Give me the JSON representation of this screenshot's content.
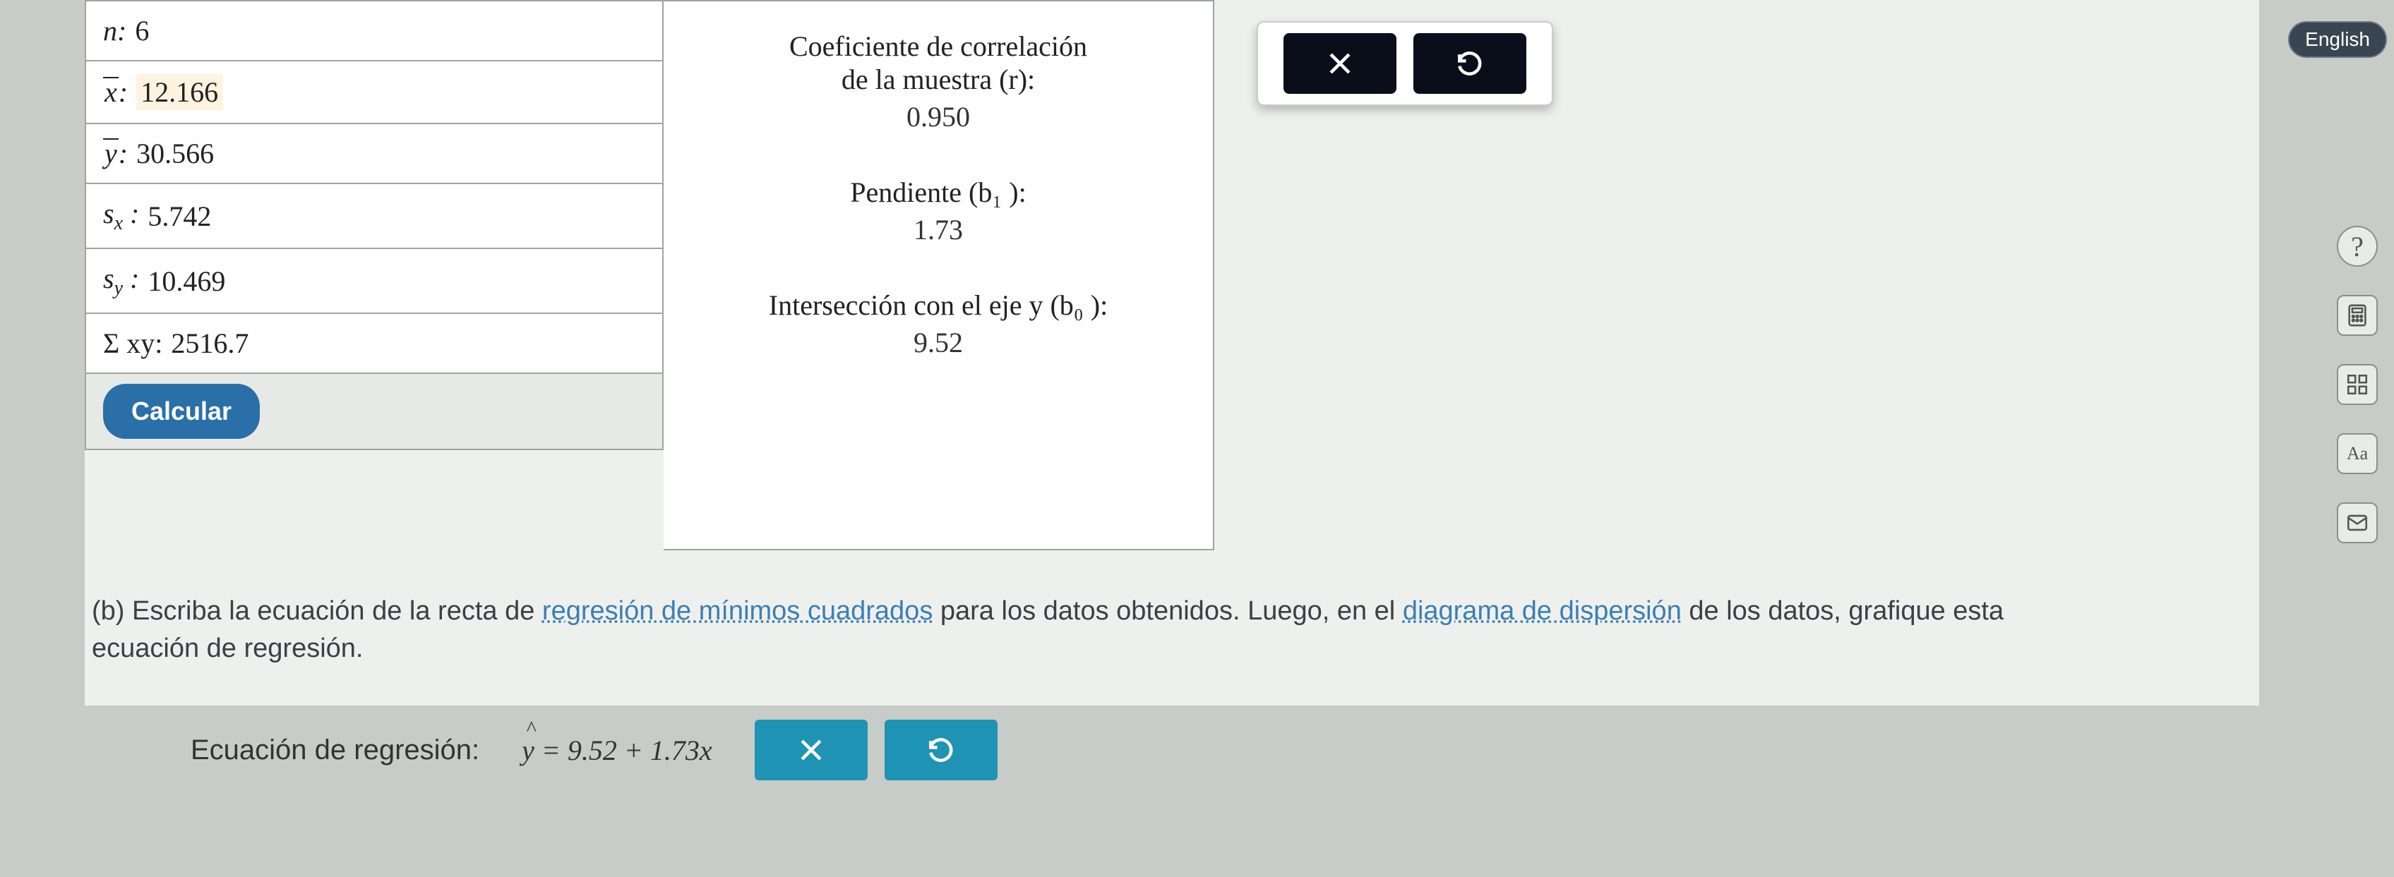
{
  "stats": {
    "n_label": "n",
    "n_value": "6",
    "xbar_label": "x",
    "xbar_value": "12.166",
    "ybar_label": "y",
    "ybar_value": "30.566",
    "sx_label_base": "s",
    "sx_label_sub": "x",
    "sx_value": "5.742",
    "sy_label_base": "s",
    "sy_label_sub": "y",
    "sy_value": "10.469",
    "sumxy_label": "Σ xy",
    "sumxy_value": "2516.7",
    "calc_button": "Calcular"
  },
  "results": {
    "r_label1": "Coeficiente de correlación",
    "r_label2": "de la muestra (r):",
    "r_value": "0.950",
    "b1_label": "Pendiente (b₁ ):",
    "b1_value": "1.73",
    "b0_label": "Intersección con el eje y (b₀ ):",
    "b0_value": "9.52"
  },
  "lang_button": "English",
  "question": {
    "part_label": "(b)",
    "t1": "Escriba la ecuación de la recta de ",
    "link1": "regresión de mínimos cuadrados",
    "t2": " para los datos obtenidos. Luego, en el ",
    "link2": "diagrama de dispersión",
    "t3": " de los datos, grafique esta ecuación de regresión."
  },
  "equation": {
    "label": "Ecuación de regresión:",
    "expr": "= 9.52 + 1.73x"
  },
  "icons": {
    "close": "close-icon",
    "undo": "undo-icon",
    "help": "?",
    "calc": "calculator-icon",
    "grid": "grid-icon",
    "aa": "Aa",
    "mail": "mail-icon"
  }
}
